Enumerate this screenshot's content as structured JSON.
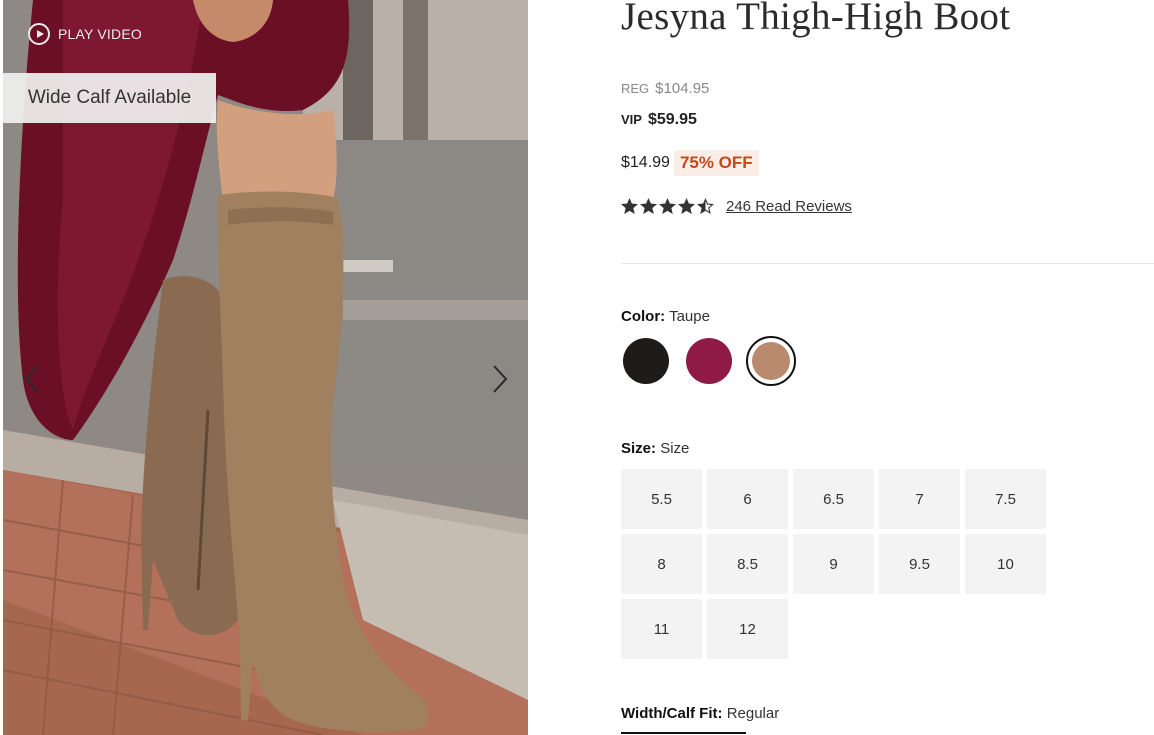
{
  "media": {
    "play_video_label": "PLAY VIDEO",
    "badge_label": "Wide Calf Available"
  },
  "product": {
    "title": "Jesyna Thigh-High Boot",
    "reg_label": "REG",
    "reg_price": "$104.95",
    "vip_label": "VIP",
    "vip_price": "$59.95",
    "sale_price": "$14.99",
    "discount": "75% OFF",
    "rating_value": 4.5,
    "review_count": "246",
    "reviews_label": "Read Reviews"
  },
  "color": {
    "label": "Color:",
    "selected": "Taupe",
    "swatches": [
      {
        "name": "Black",
        "hex": "#1e1b1b"
      },
      {
        "name": "Burgundy",
        "hex": "#8e1a45"
      },
      {
        "name": "Taupe",
        "hex": "#b98a6d"
      }
    ]
  },
  "size": {
    "label": "Size:",
    "value": "Size",
    "options": [
      "5.5",
      "6",
      "6.5",
      "7",
      "7.5",
      "8",
      "8.5",
      "9",
      "9.5",
      "10",
      "11",
      "12"
    ]
  },
  "width": {
    "label": "Width/Calf Fit:",
    "value": "Regular"
  },
  "colors": {
    "discount_text": "#c4481e",
    "discount_bg": "#fbeee6",
    "size_bg": "#f3f3f3"
  }
}
